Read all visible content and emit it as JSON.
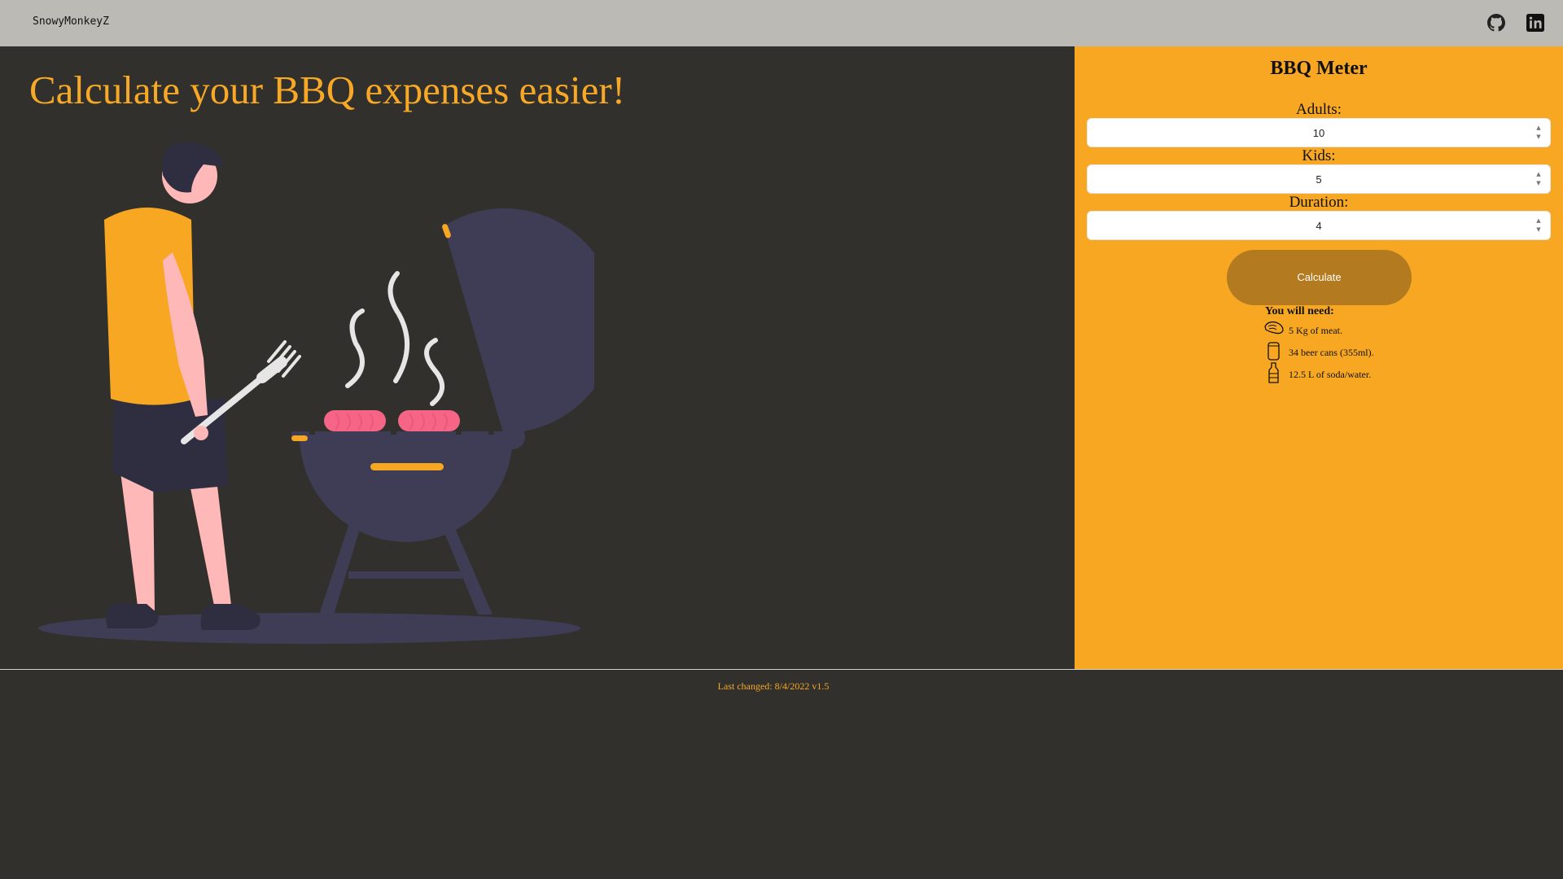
{
  "navbar": {
    "brand": "SnowyMonkeyZ",
    "icons": [
      "github-icon",
      "linkedin-icon"
    ]
  },
  "hero": {
    "title": "Calculate your BBQ expenses easier!"
  },
  "panel": {
    "title": "BBQ Meter",
    "fields": [
      {
        "label": "Adults:",
        "value": "10"
      },
      {
        "label": "Kids:",
        "value": "5"
      },
      {
        "label": "Duration:",
        "value": "4"
      }
    ],
    "button_label": "Calculate",
    "results": {
      "heading": "You will need:",
      "items": [
        {
          "icon": "steak-icon",
          "text": "5 Kg of meat."
        },
        {
          "icon": "beer-can-icon",
          "text": "34 beer cans (355ml)."
        },
        {
          "icon": "bottle-icon",
          "text": "12.5 L of soda/water."
        }
      ]
    }
  },
  "footer": {
    "text": "Last changed: 8/4/2022 v1.5"
  },
  "colors": {
    "accent": "#f8a723",
    "background": "#32302c",
    "navbar": "#bbbab5",
    "button": "#b47a1f"
  }
}
